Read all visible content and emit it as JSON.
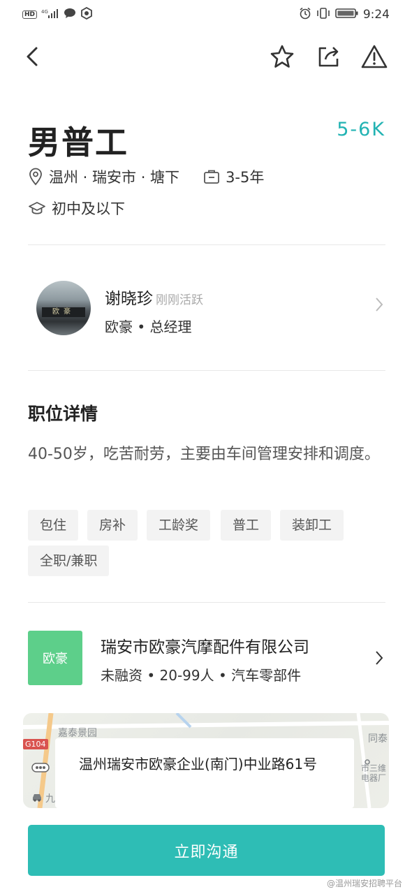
{
  "status_bar": {
    "network_badge": "HD",
    "network_type": "4G",
    "time": "9:24"
  },
  "job": {
    "title": "男普工",
    "salary": "5-6K",
    "location": "温州 · 瑞安市 · 塘下",
    "experience": "3-5年",
    "education": "初中及以下"
  },
  "recruiter": {
    "name": "谢晓珍",
    "active_status": "刚刚活跃",
    "company_role": "欧豪 • 总经理"
  },
  "details": {
    "section_title": "职位详情",
    "description": "40-50岁，吃苦耐劳，主要由车间管理安排和调度。",
    "tags": [
      "包住",
      "房补",
      "工龄奖",
      "普工",
      "装卸工",
      "全职/兼职"
    ]
  },
  "company": {
    "logo_text": "欧豪",
    "name": "瑞安市欧豪汽摩配件有限公司",
    "info": "未融资 • 20-99人 • 汽车零部件"
  },
  "map": {
    "address": "温州瑞安市欧豪企业(南门)中业路61号",
    "label_area": "嘉泰景园",
    "road_badge": "G104",
    "label_right_1": "同泰",
    "label_right_2": "市三维电器厂",
    "label_bottom": "九"
  },
  "cta": {
    "label": "立即沟通"
  },
  "watermark": "@温州瑞安招聘平台"
}
